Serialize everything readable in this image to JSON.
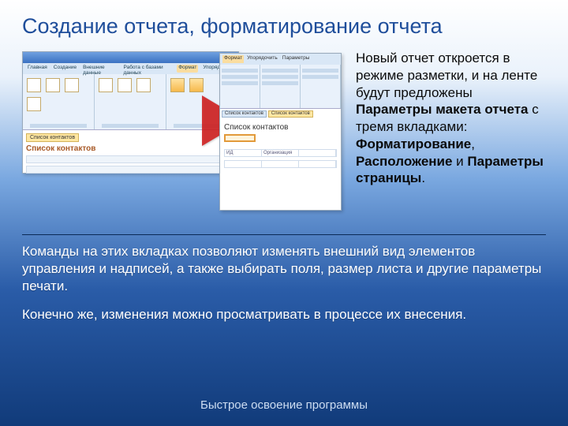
{
  "title": "Создание отчета, форматирование отчета",
  "intro": {
    "p1a": "Новый отчет откроется в режиме разметки, и на ленте будут предложены ",
    "b1": "Параметры макета отчета",
    "p1b": " с тремя вкладками: ",
    "b2": "Форматирование",
    "p1c": ", ",
    "b3": "Расположение",
    "p1d": " и ",
    "b4": "Параметры страницы",
    "p1e": "."
  },
  "para2": "Команды на этих вкладках позволяют изменять внешний вид элементов управления и надписей, а также выбирать поля, размер листа и другие параметры печати.",
  "para3": "Конечно же, изменения можно просматривать в процессе их внесения.",
  "footer": "Быстрое освоение программы",
  "shot": {
    "tabs": [
      "Главная",
      "Создание",
      "Внешние данные",
      "Работа с базами данных",
      "Формат",
      "Упорядочить"
    ],
    "docTab": "Список контактов",
    "docTitle": "Список контактов",
    "rTabs": [
      "Формат",
      "Упорядочить",
      "Параметры"
    ],
    "rMiniTabs1": "Список контактов",
    "rMiniTabs2": "Список контактов",
    "rDocTitle": "Список контактов",
    "rCols": [
      "ИД",
      "Организация"
    ]
  }
}
